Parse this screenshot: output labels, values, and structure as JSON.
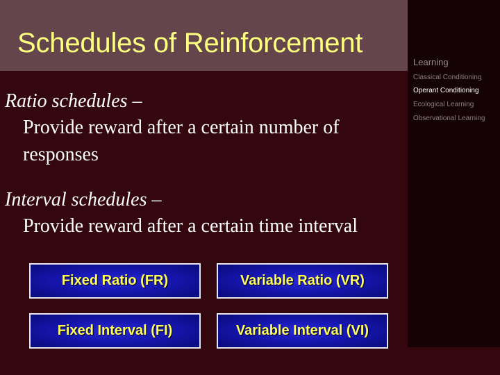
{
  "slide": {
    "title": "Schedules of Reinforcement",
    "sections": [
      {
        "heading": "Ratio schedules –",
        "lines": [
          "Provide reward after a certain number of",
          "responses"
        ]
      },
      {
        "heading": "Interval schedules –",
        "lines": [
          "Provide reward after a certain time interval"
        ]
      }
    ],
    "boxes": [
      {
        "label": "Fixed Ratio (FR)"
      },
      {
        "label": "Variable Ratio (VR)"
      },
      {
        "label": "Fixed Interval (FI)"
      },
      {
        "label": "Variable Interval (VI)"
      }
    ]
  },
  "side_nav": {
    "heading": "Learning",
    "items": [
      {
        "label": "Classical Conditioning",
        "active": false
      },
      {
        "label": "Operant Conditioning",
        "active": true
      },
      {
        "label": "Ecological Learning",
        "active": false
      },
      {
        "label": "Observational Learning",
        "active": false
      }
    ]
  },
  "colors": {
    "title_text": "#ffff80",
    "title_bar": "#63454b",
    "background": "#34060e",
    "box_fill": "#1616b0",
    "box_text": "#ffff60"
  }
}
